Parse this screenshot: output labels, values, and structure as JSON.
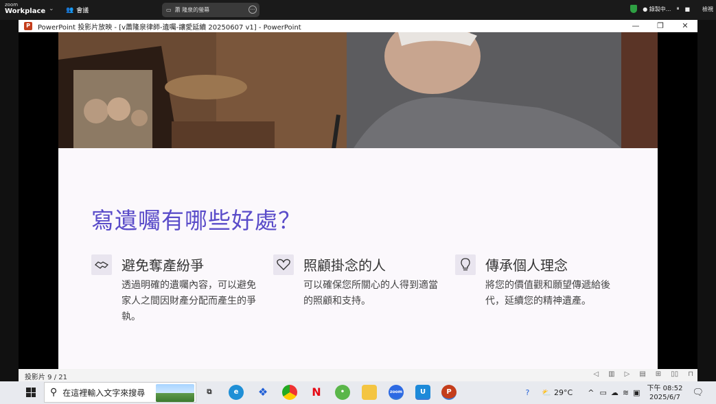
{
  "zoom": {
    "logo_line1": "zoom",
    "logo_line2": "Workplace",
    "meeting_label": "會議",
    "share_label": "蕭 隆泉的螢幕",
    "recording_label": "錄製中...",
    "view_label": "檢視"
  },
  "window": {
    "title": "PowerPoint 投影片放映 - [v蕭隆泉律師-遺囑-讓愛延續 20250607 v1] - PowerPoint",
    "app_icon": "P"
  },
  "slide": {
    "title": "寫遺囑有哪些好處？",
    "features": [
      {
        "icon": "handshake-icon",
        "title": "避免奪產紛爭",
        "desc": "透過明確的遺囑內容，可以避免家人之間因財產分配而產生的爭執。"
      },
      {
        "icon": "heart-icon",
        "title": "照顧掛念的人",
        "desc": "可以確保您所關心的人得到適當的照顧和支持。"
      },
      {
        "icon": "lightbulb-icon",
        "title": "傳承個人理念",
        "desc": "將您的價值觀和願望傳遞給後代，延續您的精神遺產。"
      }
    ]
  },
  "status": {
    "slide_counter": "投影片 9 / 21"
  },
  "taskbar": {
    "search_placeholder": "在這裡輸入文字來搜尋",
    "weather": "29°C",
    "time": "下午 08:52",
    "date": "2025/6/7"
  },
  "colors": {
    "accent": "#5a4cc9",
    "ppt": "#c43e1c"
  }
}
